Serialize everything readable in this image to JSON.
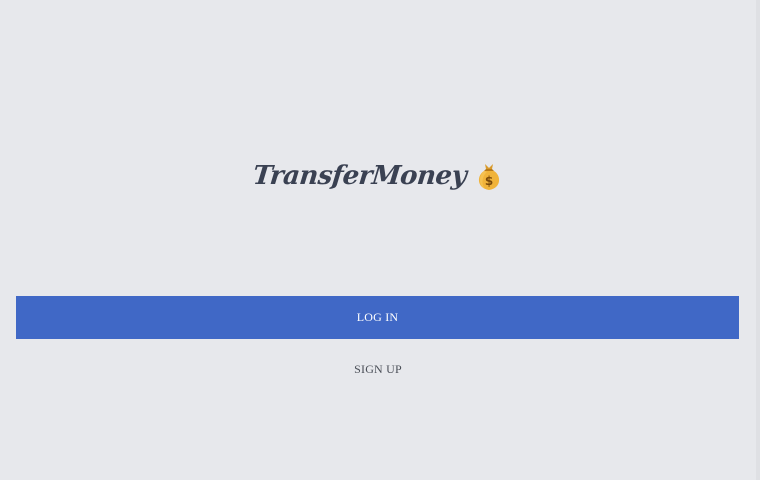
{
  "app": {
    "logo_text": "TransferMoney",
    "logo_icon": "money-bag-icon"
  },
  "actions": {
    "login_label": "LOG IN",
    "signup_label": "SIGN UP"
  },
  "colors": {
    "background": "#e7e8ec",
    "primary": "#4068c6",
    "logo_text": "#3a4152",
    "secondary_text": "#4b4f58"
  }
}
